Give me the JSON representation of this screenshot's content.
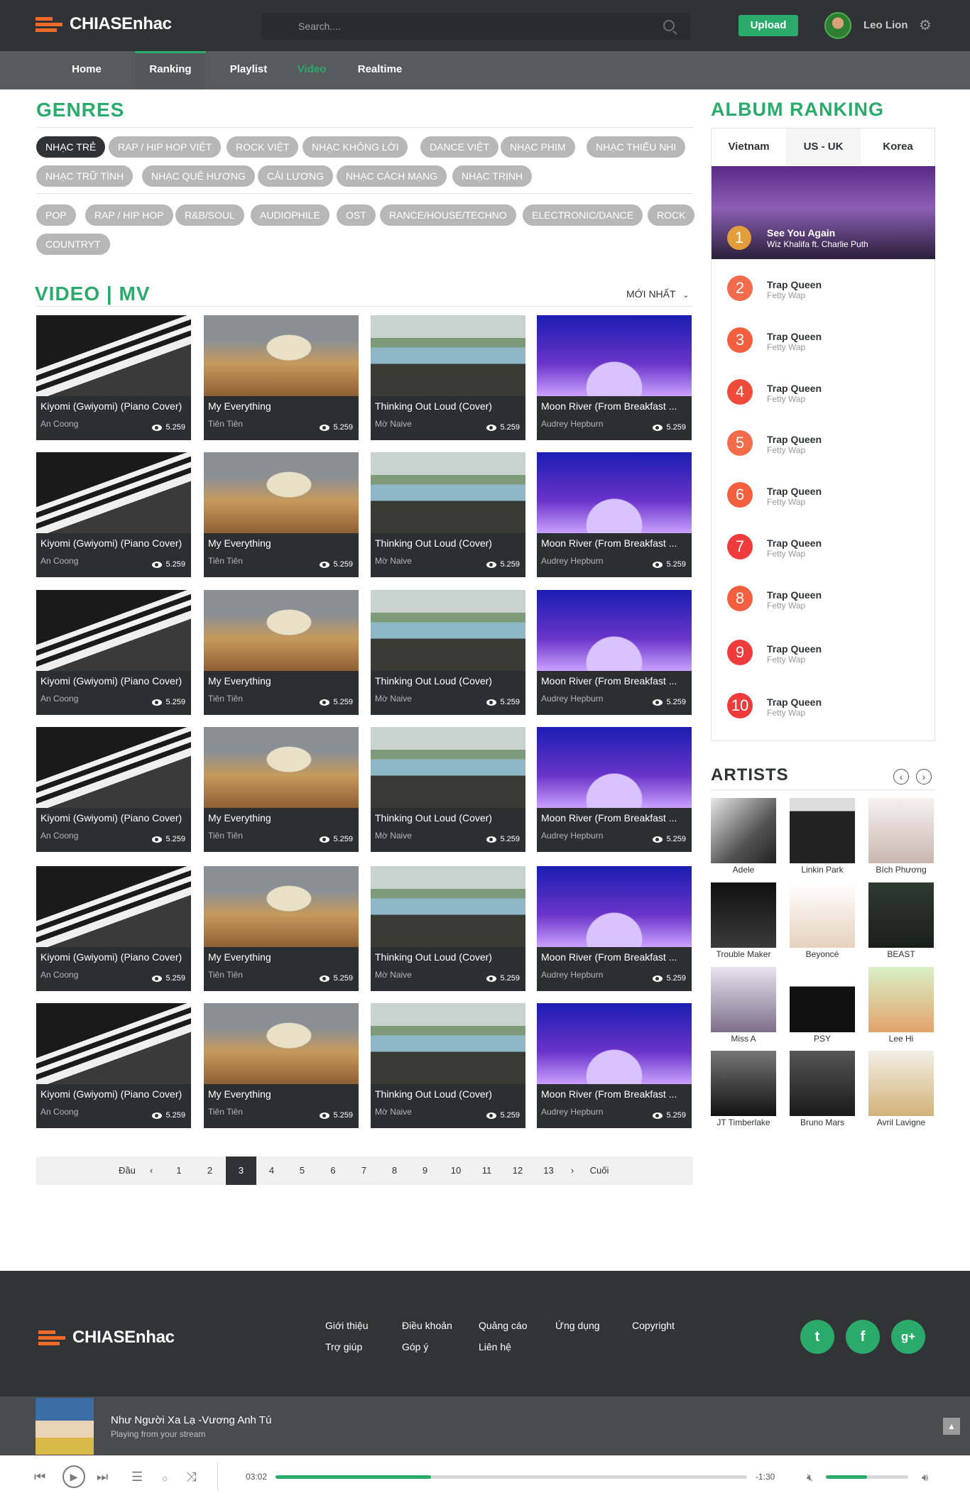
{
  "brand": {
    "name": "CHIASEnhac",
    "accent": "#2bab6b",
    "logo_color": "#f26b2a"
  },
  "header": {
    "search_placeholder": "Search....",
    "upload_label": "Upload",
    "user_name": "Leo Lion"
  },
  "nav": [
    {
      "label": "Home"
    },
    {
      "label": "Ranking",
      "active": true
    },
    {
      "label": "Playlist"
    },
    {
      "label": "Video",
      "highlight": true
    },
    {
      "label": "Realtime"
    }
  ],
  "genres": {
    "title": "GENRES",
    "tags_vn": [
      "NHẠC TRẺ",
      "RAP / HIP HOP VIỆT",
      "ROCK VIỆT",
      "NHẠC KHÔNG LỜI",
      "DANCE VIỆT",
      "NHẠC PHIM",
      "NHẠC THIẾU NHI",
      "NHẠC TRỮ TÌNH",
      "NHẠC QUÊ HƯƠNG",
      "CẢI LƯƠNG",
      "NHẠC CÁCH MẠNG",
      "NHẠC TRỊNH"
    ],
    "tags_intl": [
      "POP",
      "RAP / HIP HOP",
      "R&B/SOUL",
      "AUDIOPHILE",
      "OST",
      "RANCE/HOUSE/TECHNO",
      "ELECTRONIC/DANCE",
      "ROCK",
      "COUNTRYT"
    ]
  },
  "video": {
    "title": "VIDEO | MV",
    "sort_label": "MỚI NHẤT",
    "cards": [
      {
        "title": "Kiyomi (Gwiyomi) (Piano Cover)",
        "artist": "An Coong",
        "views": "5.259"
      },
      {
        "title": "My Everything",
        "artist": "Tiên Tiên",
        "views": "5.259"
      },
      {
        "title": "Thinking Out Loud (Cover)",
        "artist": "Mờ Naive",
        "views": "5.259"
      },
      {
        "title": "Moon River (From Breakfast ...",
        "artist": "Audrey Hepburn",
        "views": "5.259"
      }
    ]
  },
  "pagination": {
    "first": "Đầu",
    "last": "Cuối",
    "pages": [
      "1",
      "2",
      "3",
      "4",
      "5",
      "6",
      "7",
      "8",
      "9",
      "10",
      "11",
      "12",
      "13"
    ],
    "current": "3"
  },
  "album_ranking": {
    "title": "ALBUM RANKING",
    "tabs": [
      "Vietnam",
      "US - UK",
      "Korea"
    ],
    "active_tab": "US - UK",
    "featured": {
      "rank": "1",
      "title": "See You Again",
      "artist": "Wiz Khalifa ft. Charlie Puth"
    },
    "items": [
      {
        "rank": "2",
        "title": "Trap Queen",
        "artist": "Fetty Wap",
        "color": "#f26b4a"
      },
      {
        "rank": "3",
        "title": "Trap Queen",
        "artist": "Fetty Wap",
        "color": "#f2603f"
      },
      {
        "rank": "4",
        "title": "Trap Queen",
        "artist": "Fetty Wap",
        "color": "#f04a3a"
      },
      {
        "rank": "5",
        "title": "Trap Queen",
        "artist": "Fetty Wap",
        "color": "#f26b4a"
      },
      {
        "rank": "6",
        "title": "Trap Queen",
        "artist": "Fetty Wap",
        "color": "#f2603f"
      },
      {
        "rank": "7",
        "title": "Trap Queen",
        "artist": "Fetty Wap",
        "color": "#ef3b3b"
      },
      {
        "rank": "8",
        "title": "Trap Queen",
        "artist": "Fetty Wap",
        "color": "#f2603f"
      },
      {
        "rank": "9",
        "title": "Trap Queen",
        "artist": "Fetty Wap",
        "color": "#ef3b3b"
      },
      {
        "rank": "10",
        "title": "Trap Queen",
        "artist": "Fetty Wap",
        "color": "#ef3b3b"
      }
    ]
  },
  "artists": {
    "title": "ARTISTS",
    "list": [
      "Adele",
      "Linkin Park",
      "Bích Phương",
      "Trouble Maker",
      "Beyoncé",
      "BEAST",
      "Miss A",
      "PSY",
      "Lee Hi",
      "JT Timberlake",
      "Bruno Mars",
      "Avril Lavigne"
    ]
  },
  "footer": {
    "links": [
      "Giới thiệu",
      "Điều khoản",
      "Quảng cáo",
      "Ứng dụng",
      "Copyright",
      "Trợ giúp",
      "Góp ý",
      "Liên hệ"
    ],
    "social": [
      "twitter-icon",
      "facebook-icon",
      "google-plus-icon"
    ]
  },
  "player": {
    "title": "Như Người Xa Lạ -Vương Anh Tú",
    "subtitle": "Playing from your stream",
    "elapsed": "03:02",
    "remaining": "-1:30",
    "progress": 0.33,
    "volume": 0.5
  }
}
